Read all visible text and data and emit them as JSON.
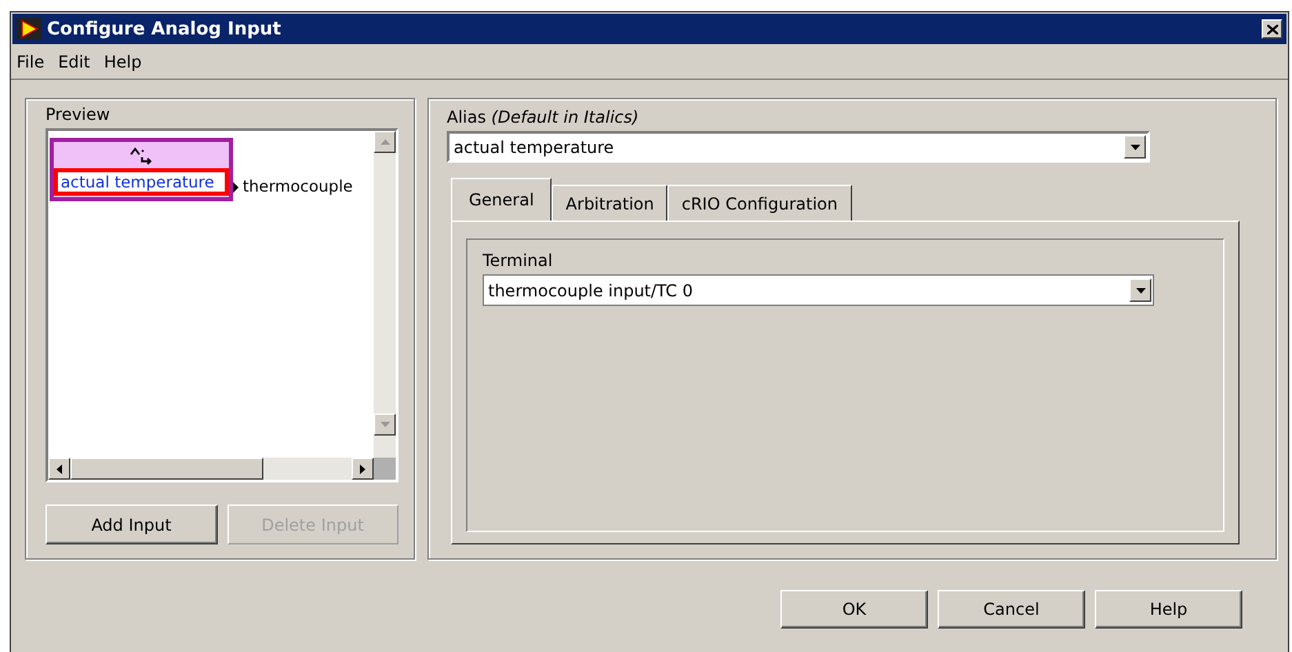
{
  "window": {
    "title": "Configure Analog Input"
  },
  "menu": [
    "File",
    "Edit",
    "Help"
  ],
  "preview": {
    "label": "Preview",
    "node": {
      "alias": "actual temperature",
      "terminal": "thermocouple"
    }
  },
  "input_buttons": [
    {
      "label": "Add Input",
      "disabled": false
    },
    {
      "label": "Delete Input",
      "disabled": true
    }
  ],
  "alias": {
    "label": "Alias *(Default in Italics)*",
    "value": "actual temperature"
  },
  "tabs": [
    {
      "label": "General",
      "selected": true
    },
    {
      "label": "Arbitration",
      "selected": false
    },
    {
      "label": "cRIO Configuration",
      "selected": false
    }
  ],
  "terminal": {
    "label": "Terminal",
    "value": "thermocouple input/TC 0"
  },
  "buttons": [
    "OK",
    "Cancel",
    "Help"
  ]
}
